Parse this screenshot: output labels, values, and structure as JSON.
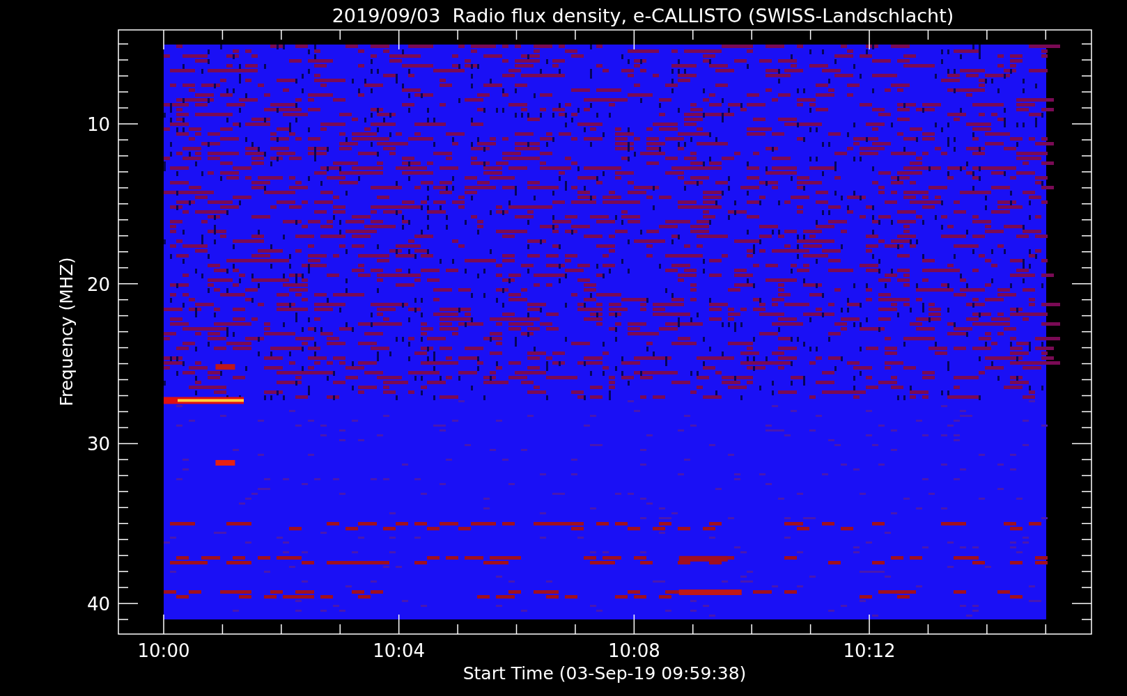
{
  "plot": {
    "title": "2019/09/03  Radio flux density, e-CALLISTO (SWISS-Landschlacht)",
    "xlabel": "Start Time (03-Sep-19 09:59:38)",
    "ylabel": "Frequency (MHZ)",
    "xticks": [
      "10:00",
      "10:04",
      "10:08",
      "10:12"
    ],
    "yticks": [
      "10",
      "20",
      "30",
      "40"
    ]
  }
}
